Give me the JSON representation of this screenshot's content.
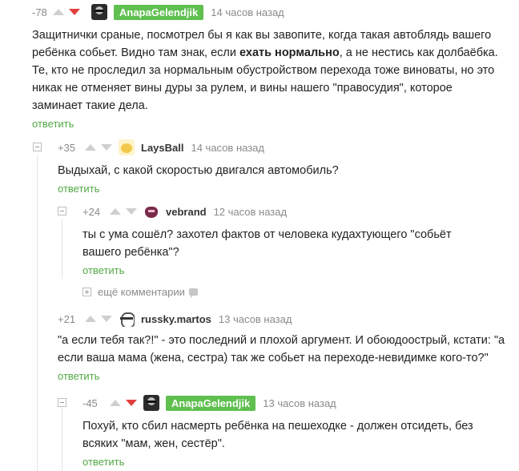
{
  "comments": [
    {
      "rating": "-78",
      "author": "AnapaGelendjik",
      "time": "14 часов назад",
      "body_1": "Защитнички сраные, посмотрел бы я как вы завопите, когда такая автоблядь вашего ребёнка собьет.  Видно там знак, если ",
      "body_bold": "ехать нормально",
      "body_2": ", а не нестись как долбаёбка. Те, кто не проследил за нормальным обустройством перехода тоже виноваты, но это никак не отменяет вины дуры за рулем, и вины нашего \"правосудия\", которое заминает такие дела.",
      "reply": "ответить"
    },
    {
      "rating": "+35",
      "author": "LaysBall",
      "time": "14 часов назад",
      "body": "Выдыхай, с какой скоростью двигался автомобиль?",
      "reply": "ответить"
    },
    {
      "rating": "+24",
      "author": "vebrand",
      "time": "12 часов назад",
      "body": "ты с ума сошёл? захотел фактов от человека кудахтующего \"собьёт вашего ребёнка\"?",
      "reply": "ответить"
    },
    {
      "rating": "+21",
      "author": "russky.martos",
      "time": "13 часов назад",
      "body": "\"а если тебя так?!\" - это последний и плохой аргумент. И обоюдоострый, кстати: \"а если ваша мама (жена, сестра) так же собьет на переходе-невидимке кого-то?\"",
      "reply": "ответить"
    },
    {
      "rating": "-45",
      "author": "AnapaGelendjik",
      "time": "13 часов назад",
      "body": "Похуй, кто сбил насмерть ребёнка на пешеходке - должен отсидеть, без всяких \"мам, жен, сестёр\".",
      "reply": "ответить"
    }
  ],
  "more_comments": "ещё комментарии"
}
